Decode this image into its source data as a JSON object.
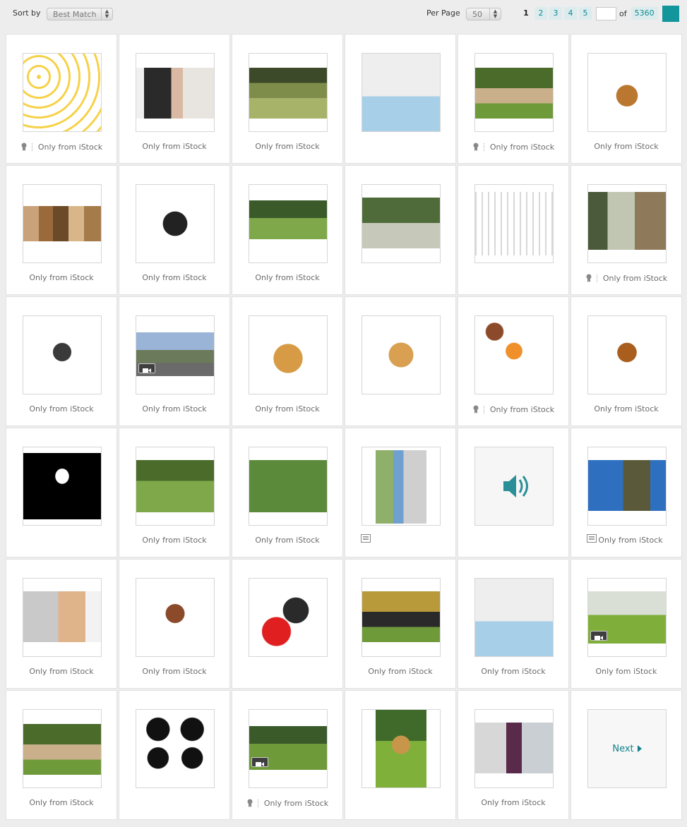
{
  "toolbar": {
    "sort_label": "Sort by",
    "sort_value": "Best Match",
    "per_page_label": "Per Page",
    "per_page_value": "50",
    "pages": [
      "1",
      "2",
      "3",
      "4",
      "5"
    ],
    "current_page": "1",
    "page_input": "",
    "of_label": "of",
    "total_pages": "5360",
    "accent_color": "#13959c"
  },
  "captions": {
    "only": "Only from iStock",
    "typo": "Only fom iStock"
  },
  "next_label": "Next",
  "cards": [
    {
      "caption": "Only from iStock",
      "badge": true,
      "kind": "pattern"
    },
    {
      "caption": "Only from iStock",
      "badge": false,
      "kind": "couple-dog"
    },
    {
      "caption": "Only from iStock",
      "badge": false,
      "kind": "running-dog"
    },
    {
      "caption": "",
      "badge": false,
      "kind": "bandaged-dog"
    },
    {
      "caption": "Only from iStock",
      "badge": true,
      "kind": "pug-grass"
    },
    {
      "caption": "Only from iStock",
      "badge": false,
      "kind": "terrier"
    },
    {
      "caption": "Only from iStock",
      "badge": false,
      "kind": "dog-group"
    },
    {
      "caption": "Only from iStock",
      "badge": false,
      "kind": "boston-terrier"
    },
    {
      "caption": "Only from iStock",
      "badge": false,
      "kind": "jogger-dog"
    },
    {
      "caption": "",
      "badge": false,
      "kind": "walk-park"
    },
    {
      "caption": "",
      "badge": false,
      "kind": "crate"
    },
    {
      "caption": "Only from iStock",
      "badge": true,
      "kind": "pug-window"
    },
    {
      "caption": "Only from iStock",
      "badge": false,
      "kind": "chihuahua"
    },
    {
      "caption": "Only from iStock",
      "badge": false,
      "kind": "car-dog",
      "video": true
    },
    {
      "caption": "Only from iStock",
      "badge": false,
      "kind": "golden-scratch"
    },
    {
      "caption": "",
      "badge": false,
      "kind": "golden-sit"
    },
    {
      "caption": "Only from iStock",
      "badge": true,
      "kind": "icons"
    },
    {
      "caption": "Only from iStock",
      "badge": false,
      "kind": "peek-dog"
    },
    {
      "caption": "",
      "badge": false,
      "kind": "silhouette"
    },
    {
      "caption": "Only from iStock",
      "badge": false,
      "kind": "red-dog"
    },
    {
      "caption": "Only from iStock",
      "badge": false,
      "kind": "two-dogs"
    },
    {
      "caption": "",
      "badge": false,
      "kind": "shopper",
      "doc": true
    },
    {
      "caption": "",
      "badge": false,
      "kind": "audio"
    },
    {
      "caption": "Only from iStock",
      "badge": false,
      "kind": "soldier",
      "doc": true
    },
    {
      "caption": "Only from iStock",
      "badge": false,
      "kind": "woman-sheepdog"
    },
    {
      "caption": "Only from iStock",
      "badge": false,
      "kind": "cartoon"
    },
    {
      "caption": "",
      "badge": false,
      "kind": "heart-puppy"
    },
    {
      "caption": "Only from iStock",
      "badge": false,
      "kind": "woman-lab"
    },
    {
      "caption": "Only from iStock",
      "badge": false,
      "kind": "bandaged-dog"
    },
    {
      "caption": "Only fom iStock",
      "badge": false,
      "kind": "meadow-dogs",
      "video": true
    },
    {
      "caption": "Only from iStock",
      "badge": false,
      "kind": "pug-grass"
    },
    {
      "caption": "",
      "badge": false,
      "kind": "silhouettes4"
    },
    {
      "caption": "Only from iStock",
      "badge": true,
      "kind": "white-puppy",
      "video": true
    },
    {
      "caption": "",
      "badge": false,
      "kind": "golden-run"
    },
    {
      "caption": "Only from iStock",
      "badge": false,
      "kind": "vet"
    },
    {
      "caption": "",
      "badge": false,
      "kind": "next"
    }
  ]
}
